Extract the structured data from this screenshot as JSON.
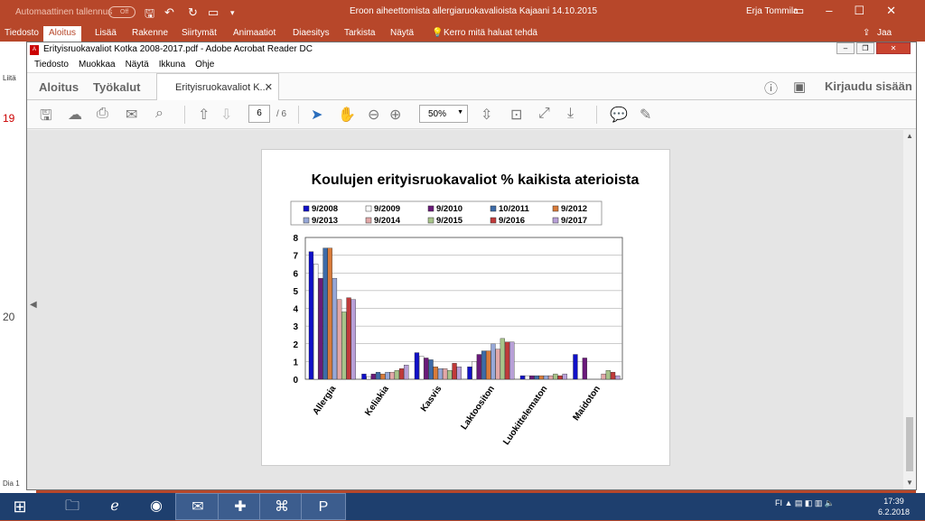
{
  "ppt": {
    "autosave_label": "Automaattinen tallennus",
    "autosave_state": "Off",
    "document_title": "Eroon aiheettomista  allergiaruokavalioista Kajaani 14.10.2015",
    "user": "Erja Tommila",
    "tabs": [
      "Tiedosto",
      "Aloitus",
      "Lisää",
      "Rakenne",
      "Siirtymät",
      "Animaatiot",
      "Diaesitys",
      "Tarkista",
      "Näytä"
    ],
    "tell_me": "Kerro mitä haluat tehdä",
    "share": "Jaa",
    "left_label": "Liitä",
    "slide_numbers": [
      "19",
      "20"
    ],
    "status": "Dia 1"
  },
  "acrobat": {
    "title": "Erityisruokavaliot Kotka 2008-2017.pdf - Adobe Acrobat Reader DC",
    "menu": [
      "Tiedosto",
      "Muokkaa",
      "Näytä",
      "Ikkuna",
      "Ohje"
    ],
    "home_tab": "Aloitus",
    "tools_tab": "Työkalut",
    "doc_tab": "Erityisruokavaliot K...",
    "signin": "Kirjaudu sisään",
    "page_current": "6",
    "page_total": "/ 6",
    "zoom": "50%"
  },
  "chart_data": {
    "type": "bar",
    "title": "Koulujen erityisruokavaliot % kaikista aterioista",
    "categories": [
      "Allergia",
      "Keliakia",
      "Kasvis",
      "Laktoositon",
      "Luokittelematon",
      "Maidoton"
    ],
    "ylim": [
      0,
      8
    ],
    "yticks": [
      0,
      1,
      2,
      3,
      4,
      5,
      6,
      7,
      8
    ],
    "legend_position": "top",
    "series": [
      {
        "name": "9/2008",
        "color": "#1010c8",
        "values": [
          7.2,
          0.3,
          1.5,
          0.7,
          0.2,
          1.4
        ]
      },
      {
        "name": "9/2009",
        "color": "#ffffff",
        "values": [
          6.5,
          0.15,
          1.3,
          1.0,
          0.2,
          0.0
        ]
      },
      {
        "name": "9/2010",
        "color": "#6a1a7a",
        "values": [
          5.7,
          0.3,
          1.2,
          1.4,
          0.2,
          1.2
        ]
      },
      {
        "name": "10/2011",
        "color": "#3d6ba8",
        "values": [
          7.4,
          0.4,
          1.1,
          1.6,
          0.2,
          0.0
        ]
      },
      {
        "name": "9/2012",
        "color": "#d87b3a",
        "values": [
          7.4,
          0.3,
          0.7,
          1.6,
          0.2,
          0.0
        ]
      },
      {
        "name": "9/2013",
        "color": "#97a8d8",
        "values": [
          5.7,
          0.4,
          0.6,
          2.0,
          0.2,
          0.0
        ]
      },
      {
        "name": "9/2014",
        "color": "#e2a8a8",
        "values": [
          4.5,
          0.4,
          0.6,
          1.7,
          0.2,
          0.3
        ]
      },
      {
        "name": "9/2015",
        "color": "#a8c48a",
        "values": [
          3.8,
          0.5,
          0.5,
          2.3,
          0.3,
          0.5
        ]
      },
      {
        "name": "9/2016",
        "color": "#c03a3a",
        "values": [
          4.6,
          0.6,
          0.9,
          2.1,
          0.2,
          0.4
        ]
      },
      {
        "name": "9/2017",
        "color": "#b8a0d8",
        "values": [
          4.5,
          0.8,
          0.7,
          2.1,
          0.3,
          0.2
        ]
      }
    ]
  },
  "taskbar": {
    "apps": [
      "start",
      "explorer",
      "ie",
      "firefox",
      "outlook",
      "viewer",
      "acrobat",
      "powerpoint"
    ],
    "tray_lang": "FI",
    "time": "17:39",
    "date": "6.2.2018"
  }
}
